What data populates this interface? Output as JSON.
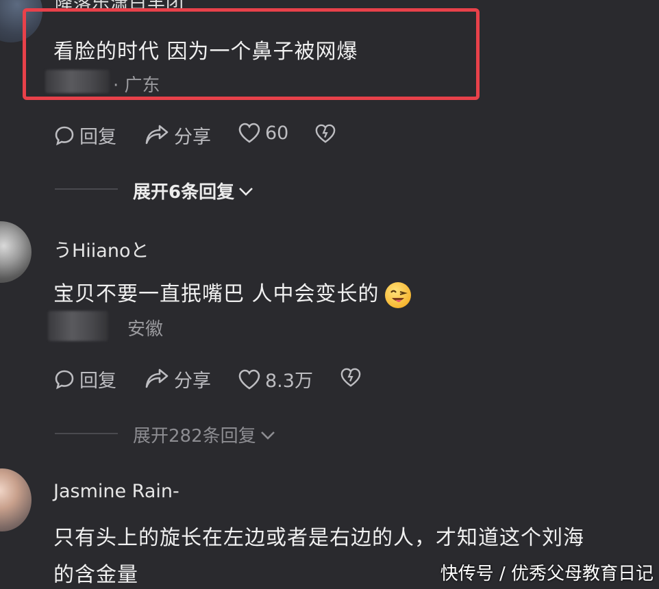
{
  "comment1": {
    "username_partial": "降落乐潇白羊团",
    "text": "看脸的时代 因为一个鼻子被网爆",
    "location": "· 广东",
    "actions": {
      "reply": "回复",
      "share": "分享",
      "likes": "60"
    },
    "expand": "展开6条回复"
  },
  "comment2": {
    "username": "うHiianoと",
    "text": "宝贝不要一直抿嘴巴 人中会变长的",
    "emoji": "wink-tongue-emoji",
    "location": "安徽",
    "actions": {
      "reply": "回复",
      "share": "分享",
      "likes": "8.3万"
    },
    "expand": "展开282条回复"
  },
  "comment3": {
    "username": "Jasmine Rain-",
    "text_line1": "只有头上的旋长在左边或者是右边的人，才知道这个刘海",
    "text_line2": "的含金量"
  },
  "watermark": "快传号 / 优秀父母教育日记",
  "colors": {
    "background": "#2a2a2e",
    "highlight": "#e8414a",
    "text": "#f0f0f0",
    "muted": "#9a9a9e"
  }
}
